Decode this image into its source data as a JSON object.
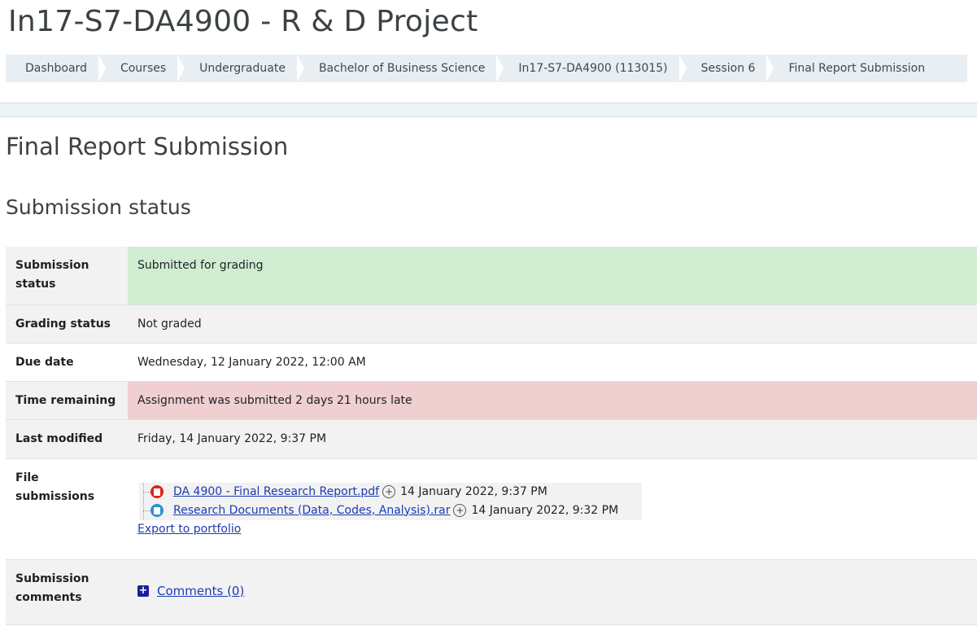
{
  "course": {
    "title": "In17-S7-DA4900 - R & D Project"
  },
  "breadcrumb": [
    "Dashboard",
    "Courses",
    "Undergraduate",
    "Bachelor of Business Science",
    "In17-S7-DA4900 (113015)",
    "Session 6",
    "Final Report Submission"
  ],
  "page": {
    "heading": "Final Report Submission",
    "section_heading": "Submission status"
  },
  "status_table": {
    "submission_status": {
      "label": "Submission status",
      "value": "Submitted for grading"
    },
    "grading_status": {
      "label": "Grading status",
      "value": "Not graded"
    },
    "due_date": {
      "label": "Due date",
      "value": "Wednesday, 12 January 2022, 12:00 AM"
    },
    "time_remaining": {
      "label": "Time remaining",
      "value": "Assignment was submitted 2 days 21 hours late"
    },
    "last_modified": {
      "label": "Last modified",
      "value": "Friday, 14 January 2022, 9:37 PM"
    },
    "file_submissions": {
      "label": "File submissions",
      "files": [
        {
          "name": "DA 4900 - Final Research Report.pdf",
          "date": "14 January 2022, 9:37 PM",
          "icon": "pdf-file-icon"
        },
        {
          "name": "Research Documents (Data, Codes, Analysis).rar",
          "date": "14 January 2022, 9:32 PM",
          "icon": "archive-file-icon"
        }
      ],
      "export_label": "Export to portfolio"
    },
    "submission_comments": {
      "label": "Submission comments",
      "link": "Comments (0)"
    }
  },
  "colors": {
    "ok": "#d0edd2",
    "late": "#f0cfd1",
    "link": "#1a3bb3"
  }
}
